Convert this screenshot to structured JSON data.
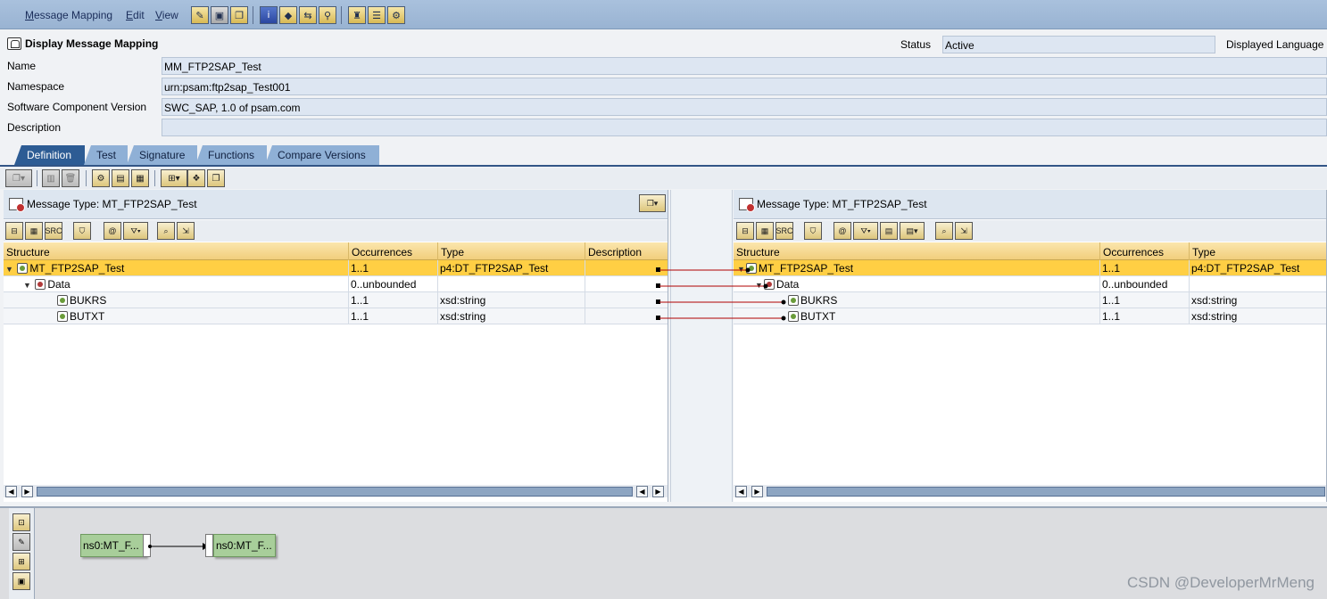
{
  "menu": {
    "items": [
      {
        "label": "Message Mapping"
      },
      {
        "label": "Edit"
      },
      {
        "label": "View"
      }
    ]
  },
  "toolbar_icons": [
    "change-icon",
    "save-icon",
    "copy-icon",
    "info-icon",
    "eraser-icon",
    "navigate-icon",
    "where-used-icon",
    "hat-icon",
    "list-icon",
    "settings-icon"
  ],
  "header": {
    "title": "Display Message Mapping",
    "status_label": "Status",
    "status_value": "Active",
    "language_label": "Displayed Language"
  },
  "attributes": [
    {
      "label": "Name",
      "value": "MM_FTP2SAP_Test"
    },
    {
      "label": "Namespace",
      "value": "urn:psam:ftp2sap_Test001"
    },
    {
      "label": "Software Component Version",
      "value": "SWC_SAP, 1.0 of psam.com"
    },
    {
      "label": "Description",
      "value": ""
    }
  ],
  "tabs": [
    {
      "label": "Definition",
      "active": true
    },
    {
      "label": "Test"
    },
    {
      "label": "Signature"
    },
    {
      "label": "Functions"
    },
    {
      "label": "Compare Versions"
    }
  ],
  "source": {
    "title": "Message Type: MT_FTP2SAP_Test",
    "columns": [
      "Structure",
      "Occurrences",
      "Type",
      "Description"
    ],
    "rows": [
      {
        "name": "MT_FTP2SAP_Test",
        "occ": "1..1",
        "type": "p4:DT_FTP2SAP_Test",
        "desc": "",
        "selected": true
      },
      {
        "name": "Data",
        "occ": "0..unbounded",
        "type": "",
        "desc": ""
      },
      {
        "name": "BUKRS",
        "occ": "1..1",
        "type": "xsd:string",
        "desc": ""
      },
      {
        "name": "BUTXT",
        "occ": "1..1",
        "type": "xsd:string",
        "desc": ""
      }
    ]
  },
  "target": {
    "title": "Message Type: MT_FTP2SAP_Test",
    "columns": [
      "Structure",
      "Occurrences",
      "Type"
    ],
    "rows": [
      {
        "name": "MT_FTP2SAP_Test",
        "occ": "1..1",
        "type": "p4:DT_FTP2SAP_Test",
        "selected": true
      },
      {
        "name": "Data",
        "occ": "0..unbounded",
        "type": ""
      },
      {
        "name": "BUKRS",
        "occ": "1..1",
        "type": "xsd:string"
      },
      {
        "name": "BUTXT",
        "occ": "1..1",
        "type": "xsd:string"
      }
    ]
  },
  "overview": {
    "source_node": "ns0:MT_F...",
    "target_node": "ns0:MT_F..."
  },
  "colors": {
    "link": "#b00000",
    "selected_row": "#ffcf44",
    "active_tab": "#2d5c94"
  },
  "watermark": "CSDN @DeveloperMrMeng"
}
